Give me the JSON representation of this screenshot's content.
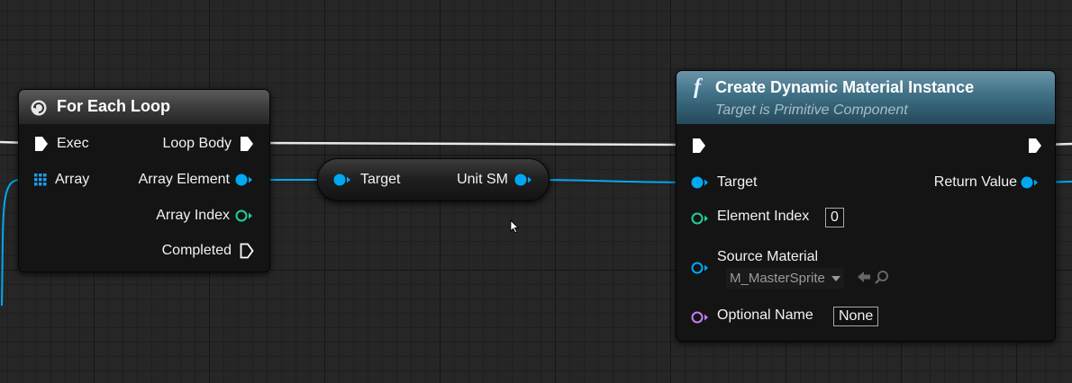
{
  "for_each": {
    "title": "For Each Loop",
    "pins": {
      "exec": "Exec",
      "loop_body": "Loop Body",
      "array": "Array",
      "array_element": "Array Element",
      "array_index": "Array Index",
      "completed": "Completed"
    }
  },
  "getter": {
    "target": "Target",
    "output": "Unit SM"
  },
  "create": {
    "title": "Create Dynamic Material Instance",
    "subtitle": "Target is Primitive Component",
    "function_glyph": "f",
    "pins": {
      "target": "Target",
      "return_value": "Return Value",
      "element_index": "Element Index",
      "element_index_value": "0",
      "source_material": "Source Material",
      "source_material_value": "M_MasterSprite",
      "optional_name": "Optional Name",
      "optional_name_value": "None"
    }
  },
  "colors": {
    "exec": "#ffffff",
    "object": "#00a8f3",
    "integer": "#1ecf9f",
    "name": "#c87cf4",
    "function_header": "#3a6b80",
    "macro_header": "#4a4a4a"
  },
  "icons": {
    "loop_macro": "loop-macro-icon",
    "function": "function-icon",
    "array": "array-grid-icon",
    "use_selected": "use-selected-arrow-icon",
    "browse": "browse-magnifier-icon",
    "cursor": "mouse-cursor-icon"
  }
}
